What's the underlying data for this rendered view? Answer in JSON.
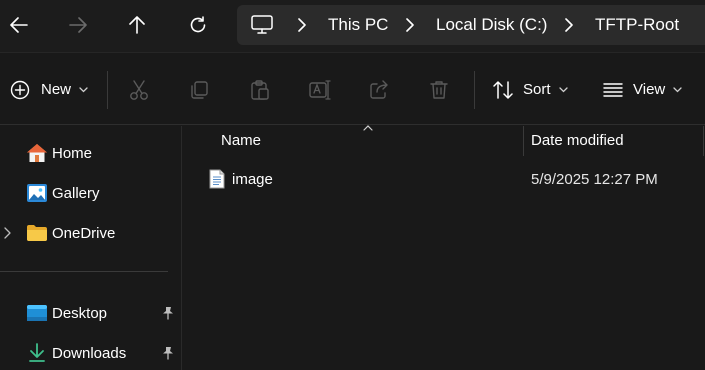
{
  "nav": {
    "back_icon": "arrow-left-icon",
    "forward_icon": "arrow-right-icon",
    "up_icon": "arrow-up-icon",
    "refresh_icon": "refresh-icon"
  },
  "breadcrumb": {
    "root_icon": "monitor-icon",
    "items": [
      {
        "label": "This PC"
      },
      {
        "label": "Local Disk (C:)"
      },
      {
        "label": "TFTP-Root"
      }
    ]
  },
  "toolbar": {
    "new_label": "New",
    "sort_label": "Sort",
    "view_label": "View",
    "icons": [
      "plus-circle-icon",
      "cut-icon",
      "copy-icon",
      "paste-icon",
      "rename-icon",
      "share-icon",
      "delete-icon",
      "sort-icon",
      "view-icon"
    ]
  },
  "sidebar": {
    "items": [
      {
        "label": "Home",
        "icon": "home-icon"
      },
      {
        "label": "Gallery",
        "icon": "gallery-icon"
      },
      {
        "label": "OneDrive",
        "icon": "folder-icon"
      },
      {
        "label": "Desktop",
        "icon": "desktop-icon"
      },
      {
        "label": "Downloads",
        "icon": "download-icon"
      }
    ]
  },
  "columns": {
    "name": "Name",
    "date_modified": "Date modified"
  },
  "files": [
    {
      "name": "image",
      "date_modified": "5/9/2025 12:27 PM",
      "icon": "text-file-icon"
    }
  ],
  "colors": {
    "background": "#191919",
    "address_bar": "#2b2b2b",
    "accent_blue": "#4cc2ff",
    "folder_yellow": "#f7c948"
  }
}
